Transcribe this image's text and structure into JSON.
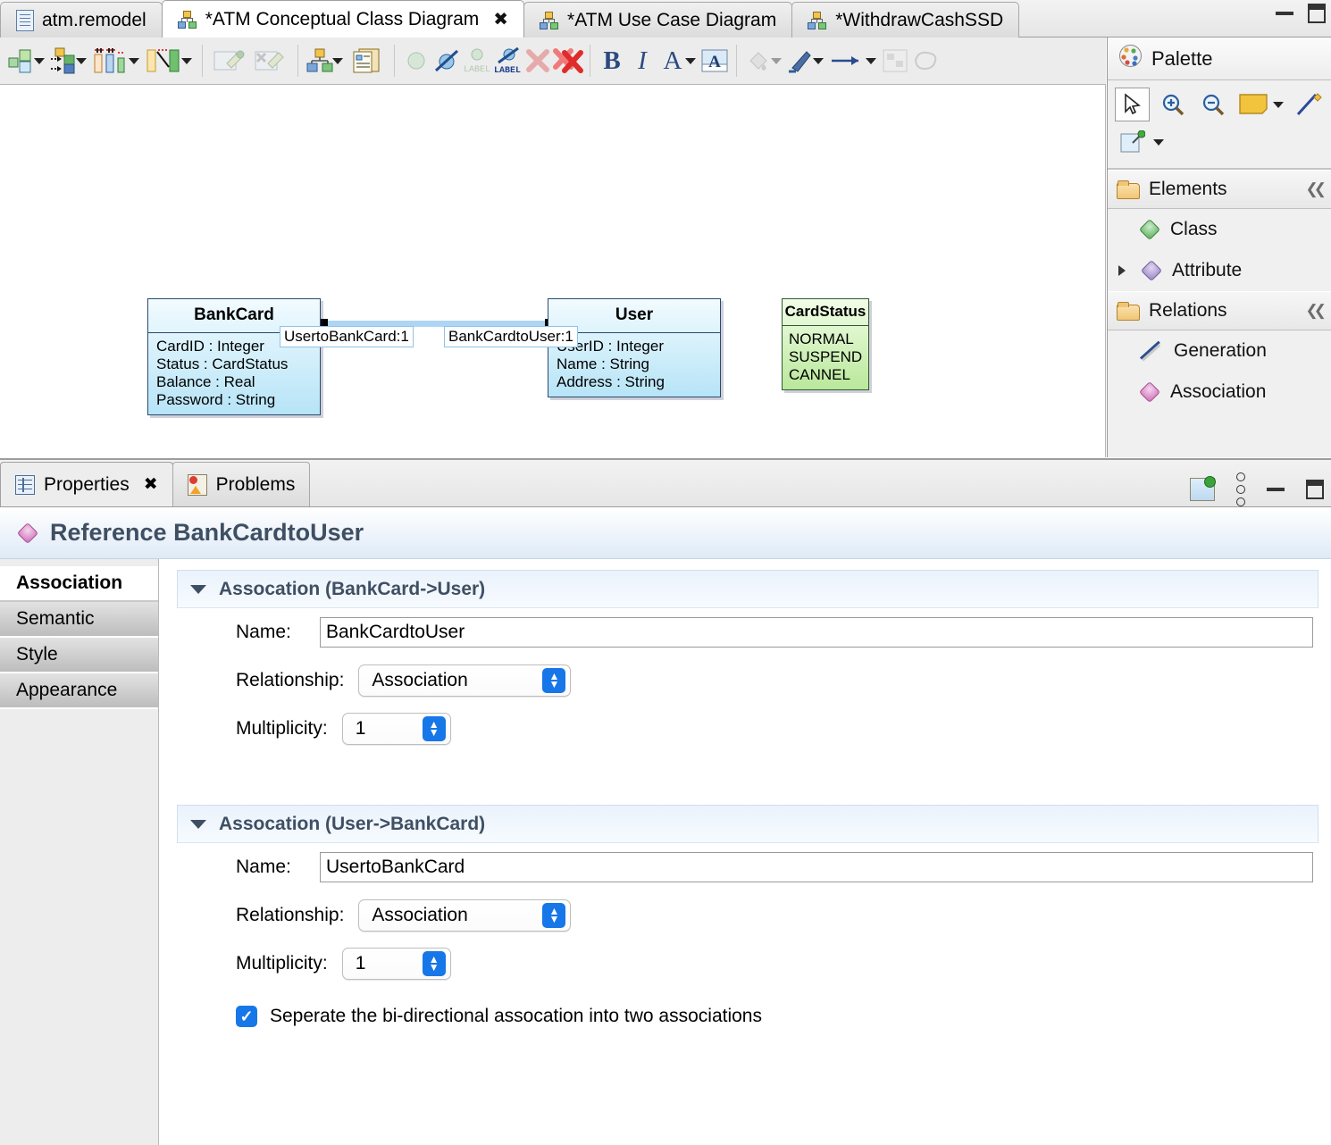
{
  "editor_tabs": [
    {
      "label": "atm.remodel",
      "icon": "document-icon",
      "active": false,
      "closable": false,
      "dirty": false
    },
    {
      "label": "*ATM Conceptual Class Diagram",
      "icon": "class-diagram-icon",
      "active": true,
      "closable": true,
      "dirty": true
    },
    {
      "label": "*ATM Use Case Diagram",
      "icon": "class-diagram-icon",
      "active": false,
      "closable": false,
      "dirty": true
    },
    {
      "label": "*WithdrawCashSSD",
      "icon": "class-diagram-icon",
      "active": false,
      "closable": false,
      "dirty": true
    }
  ],
  "window_controls": {
    "minimize": "minimize-icon",
    "maximize": "maximize-icon"
  },
  "toolbar": {
    "groups": [
      {
        "buttons": [
          {
            "name": "add-class-tool",
            "dropdown": true
          },
          {
            "name": "add-association-tool",
            "dropdown": true
          },
          {
            "name": "add-attribute-tool",
            "dropdown": true
          },
          {
            "name": "add-generation-tool",
            "dropdown": true
          }
        ]
      },
      {
        "buttons": [
          {
            "name": "add-note-tool",
            "dropdown": false,
            "disabled": true
          },
          {
            "name": "delete-note-tool",
            "dropdown": false,
            "disabled": true
          }
        ]
      },
      {
        "buttons": [
          {
            "name": "diagram-tool",
            "dropdown": true
          },
          {
            "name": "copy-diagram-tool",
            "dropdown": false
          }
        ]
      },
      {
        "buttons": [
          {
            "name": "show-node-tool",
            "dropdown": false,
            "disabled": true
          },
          {
            "name": "hide-node-tool",
            "dropdown": false
          },
          {
            "name": "show-label-tool",
            "dropdown": false,
            "disabled": true
          },
          {
            "name": "hide-label-tool",
            "dropdown": false
          },
          {
            "name": "delete-element-tool",
            "dropdown": false,
            "disabled": true
          },
          {
            "name": "delete-all-tool",
            "dropdown": false
          }
        ]
      },
      {
        "buttons": [
          {
            "name": "bold-tool",
            "label": "B"
          },
          {
            "name": "italic-tool",
            "label": "I"
          },
          {
            "name": "font-color-tool",
            "label": "A",
            "dropdown": true
          },
          {
            "name": "font-tool"
          }
        ]
      },
      {
        "buttons": [
          {
            "name": "fill-color-tool",
            "dropdown": true,
            "disabled": true
          },
          {
            "name": "line-color-tool",
            "dropdown": true
          },
          {
            "name": "line-style-tool",
            "dropdown": true
          },
          {
            "name": "layout-tool",
            "disabled": true
          },
          {
            "name": "shape-tool",
            "disabled": true
          }
        ]
      }
    ]
  },
  "diagram": {
    "classes": [
      {
        "name": "BankCard",
        "kind": "class",
        "attributes": [
          "CardID : Integer",
          "Status : CardStatus",
          "Balance : Real",
          "Password : String"
        ]
      },
      {
        "name": "User",
        "kind": "class",
        "attributes": [
          "UserID : Integer",
          "Name : String",
          "Address : String"
        ]
      },
      {
        "name": "CardStatus",
        "kind": "enumeration",
        "attributes": [
          "NORMAL",
          "SUSPEND",
          "CANNEL"
        ]
      }
    ],
    "association_labels": [
      "UsertoBankCard:1",
      "BankCardtoUser:1"
    ]
  },
  "palette": {
    "title": "Palette",
    "tools": [
      {
        "name": "select-tool",
        "selected": true
      },
      {
        "name": "zoom-in-tool",
        "selected": false
      },
      {
        "name": "zoom-out-tool",
        "selected": false
      },
      {
        "name": "note-tool",
        "selected": false,
        "dropdown": true
      },
      {
        "name": "connection-tool",
        "selected": false
      },
      {
        "name": "pin-tool",
        "selected": false,
        "dropdown": true
      }
    ],
    "sections": [
      {
        "label": "Elements",
        "collapse_icon": "double-chevron-icon",
        "items": [
          {
            "label": "Class",
            "icon": "green-diamond-icon",
            "expandable": false
          },
          {
            "label": "Attribute",
            "icon": "purple-diamond-icon",
            "expandable": true
          }
        ]
      },
      {
        "label": "Relations",
        "collapse_icon": "double-chevron-icon",
        "items": [
          {
            "label": "Generation",
            "icon": "generation-line-icon",
            "expandable": false
          },
          {
            "label": "Association",
            "icon": "magenta-diamond-icon",
            "expandable": false
          }
        ]
      }
    ]
  },
  "properties_view": {
    "tabs": [
      {
        "label": "Properties",
        "icon": "grid-icon",
        "active": true,
        "closable": true
      },
      {
        "label": "Problems",
        "icon": "problems-icon",
        "active": false,
        "closable": false
      }
    ],
    "controls": [
      {
        "name": "pin-view-button",
        "icon": "pin-icon"
      },
      {
        "name": "view-menu-button",
        "icon": "three-dots-icon"
      },
      {
        "name": "minimize-view-button",
        "icon": "minimize-icon"
      },
      {
        "name": "maximize-view-button",
        "icon": "maximize-icon"
      }
    ],
    "header": {
      "icon": "magenta-diamond-icon",
      "title": "Reference BankCardtoUser"
    },
    "section_tabs": [
      {
        "label": "Association",
        "active": true
      },
      {
        "label": "Semantic",
        "active": false
      },
      {
        "label": "Style",
        "active": false
      },
      {
        "label": "Appearance",
        "active": false
      }
    ],
    "form_sections": [
      {
        "title": "Assocation (BankCard->User)",
        "expanded": true,
        "name_label": "Name:",
        "name_value": "BankCardtoUser",
        "relationship_label": "Relationship:",
        "relationship_value": "Association",
        "multiplicity_label": "Multiplicity:",
        "multiplicity_value": "1"
      },
      {
        "title": "Assocation (User->BankCard)",
        "expanded": true,
        "name_label": "Name:",
        "name_value": "UsertoBankCard",
        "relationship_label": "Relationship:",
        "relationship_value": "Association",
        "multiplicity_label": "Multiplicity:",
        "multiplicity_value": "1"
      }
    ],
    "checkbox": {
      "checked": true,
      "label": "Seperate the bi-directional assocation into two associations"
    }
  },
  "colors": {
    "class_fill": "#b6e4f7",
    "class_border": "#2b4a6f",
    "enum_fill": "#b9e89a",
    "enum_border": "#2f5a2f",
    "accent_blue": "#1777e8",
    "header_text": "#3f4f63",
    "association_line": "#aed6f4"
  }
}
